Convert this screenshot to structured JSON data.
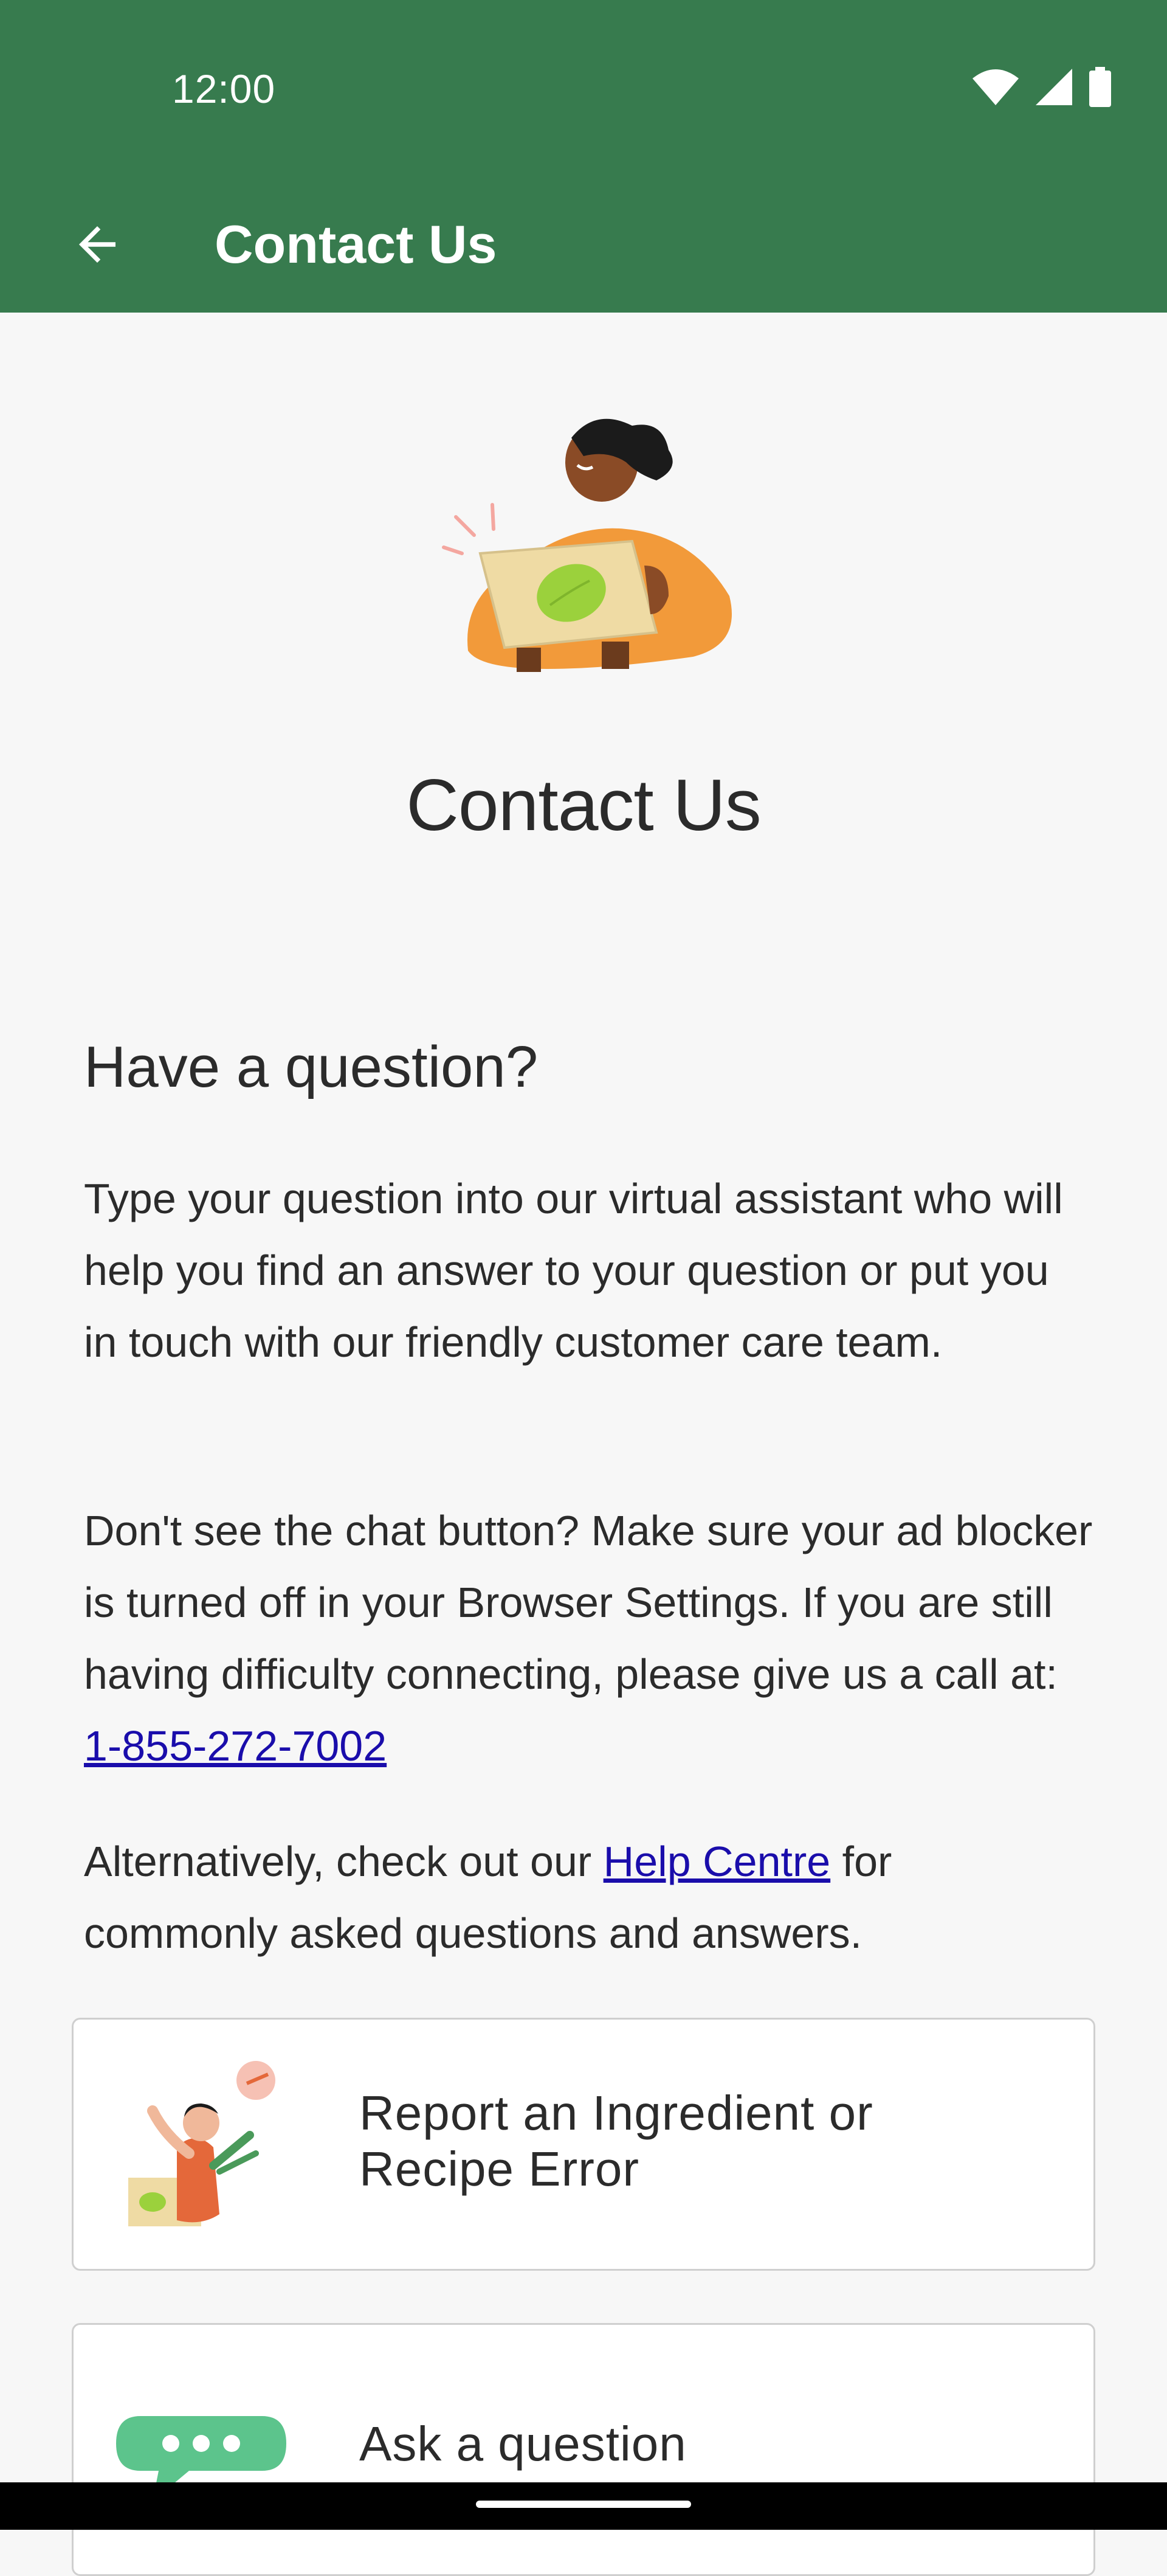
{
  "status_bar": {
    "time": "12:00"
  },
  "app_bar": {
    "title": "Contact Us"
  },
  "page_title": "Contact Us",
  "section": {
    "heading": "Have a question?",
    "paragraph1": "Type your question into our virtual assistant who will help you find an answer to your question or put you in touch with our friendly customer care team.",
    "paragraph2_text": "Don't see the chat button? Make sure your ad blocker is turned off in your Browser Settings. If you are still having difficulty connecting, please give us a call at: ",
    "phone_link": "1-855-272-7002",
    "paragraph3_before": "Alternatively, check out our ",
    "help_link": "Help Centre",
    "paragraph3_after": " for commonly asked questions and answers."
  },
  "cards": {
    "report": {
      "label_line1": "Report an Ingredient or",
      "label_line2": "Recipe Error"
    },
    "ask": {
      "label": "Ask a question"
    }
  },
  "colors": {
    "brand_green": "#377b4e",
    "link": "#1a0dab",
    "accent_orange": "#f29a3a",
    "chat_green": "#5cc48c"
  },
  "icons": [
    "wifi-icon",
    "cell-signal-icon",
    "battery-icon",
    "back-arrow-icon"
  ]
}
